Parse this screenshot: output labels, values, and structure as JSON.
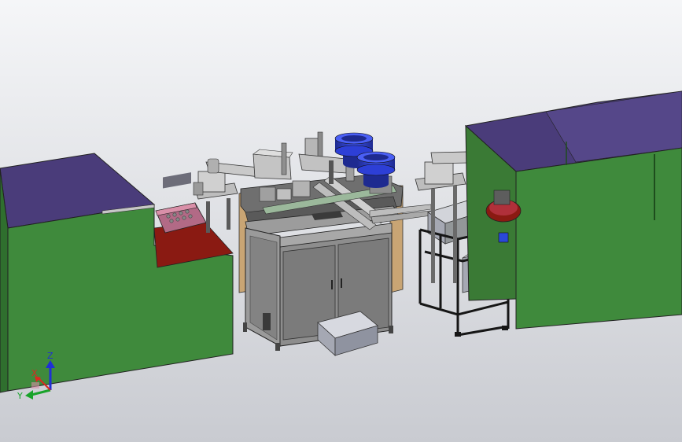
{
  "viewport": {
    "background_top": "#f5f6f8",
    "background_bottom": "#c9cbd1"
  },
  "colors": {
    "enclosure_green": "#3f8a3c",
    "enclosure_green_dark": "#2f6f2e",
    "enclosure_green_light": "#4fa047",
    "enclosure_top_purple": "#4a3c7a",
    "frame_gray": "#8d8d8d",
    "panel_gray": "#7d7d7d",
    "panel_dark": "#5d5d5d",
    "bowl_blue": "#2d3fd6",
    "bowl_blue_dark": "#1e2a90",
    "fixture_red": "#8a1a12",
    "fixture_pink": "#d98fa8",
    "tote_gray": "#a5a8b3",
    "black_frame": "#161616",
    "wood_tan": "#c9a574",
    "axis_blue": "#1f2fd6",
    "axis_green": "#18a32a",
    "axis_red": "#d92a20"
  },
  "axis_triad": {
    "z_label": "Z",
    "y_label": "Y",
    "x_label": "X"
  }
}
